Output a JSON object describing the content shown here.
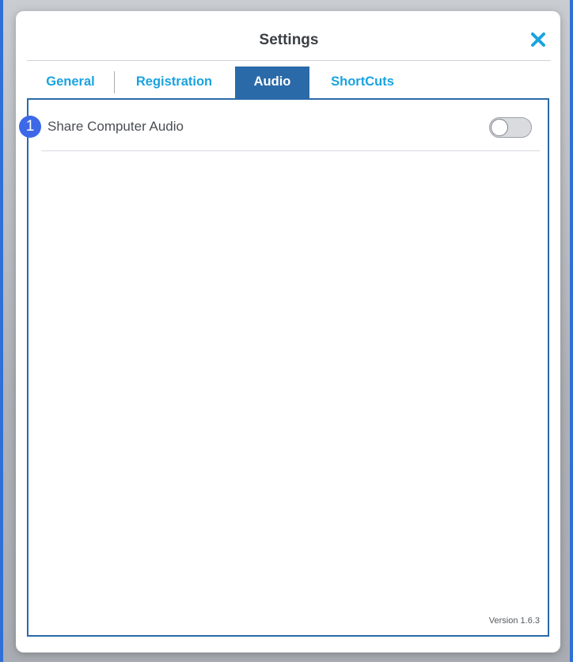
{
  "dialog": {
    "title": "Settings",
    "close_icon": "close-icon",
    "accent_color": "#2a6aa8",
    "link_color": "#1aa3e0"
  },
  "tabs": [
    {
      "label": "General",
      "active": false
    },
    {
      "label": "Registration",
      "active": false
    },
    {
      "label": "Audio",
      "active": true
    },
    {
      "label": "ShortCuts",
      "active": false
    }
  ],
  "audio": {
    "share_computer_audio": {
      "label": "Share Computer Audio",
      "enabled": false
    }
  },
  "annotation": {
    "badge_number": "1",
    "badge_color": "#3d68e8"
  },
  "footer": {
    "version": "Version 1.6.3"
  }
}
